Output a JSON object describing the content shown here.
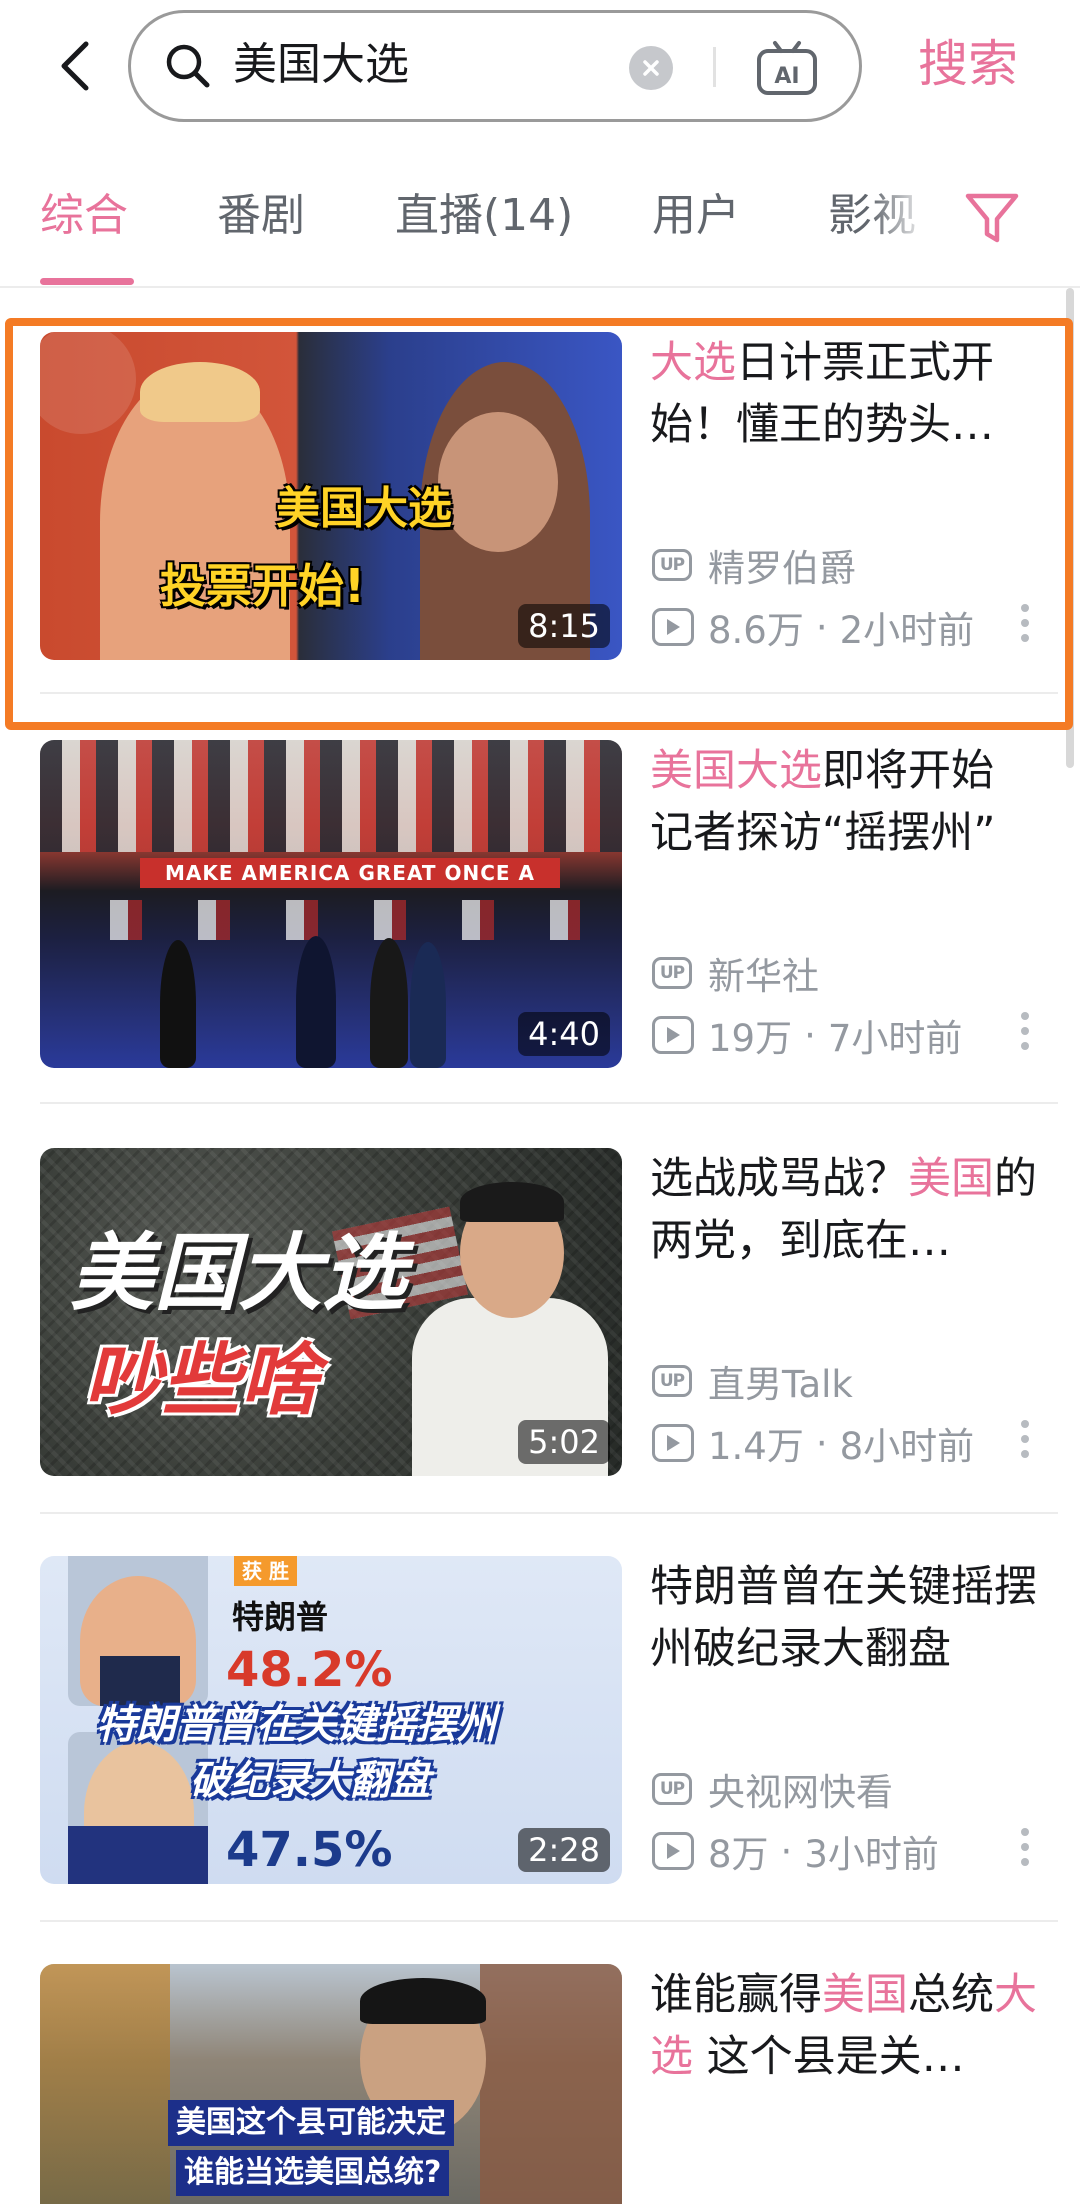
{
  "search": {
    "query": "美国大选",
    "ai_label": "AI",
    "submit_label": "搜索"
  },
  "tabs": [
    {
      "label": "综合",
      "active": true
    },
    {
      "label": "番剧",
      "active": false
    },
    {
      "label": "直播(14)",
      "active": false
    },
    {
      "label": "用户",
      "active": false
    },
    {
      "label": "影视",
      "active": false
    }
  ],
  "results": [
    {
      "title_highlight": "大选",
      "title_rest": "日计票正式开始！懂王的势头…",
      "uploader": "精罗伯爵",
      "views": "8.6万",
      "time": "2小时前",
      "duration": "8:15",
      "thumb_caption_1": "美国大选",
      "thumb_caption_2": "投票开始!"
    },
    {
      "title_highlight": "美国大选",
      "title_rest": "即将开始 记者探访“摇摆州”",
      "uploader": "新华社",
      "views": "19万",
      "time": "7小时前",
      "duration": "4:40",
      "thumb_caption_1": "MAKE AMERICA GREAT ONCE A"
    },
    {
      "title_prefix": "选战成骂战？",
      "title_highlight": "美国",
      "title_rest": "的两党，到底在…",
      "uploader": "直男Talk",
      "views": "1.4万",
      "time": "8小时前",
      "duration": "5:02",
      "thumb_caption_1": "美国大选",
      "thumb_caption_2": "吵些啥"
    },
    {
      "title_rest": "特朗普曾在关键摇摆州破纪录大翻盘",
      "uploader": "央视网快看",
      "views": "8万",
      "time": "3小时前",
      "duration": "2:28",
      "thumb_tag": "获 胜",
      "thumb_name": "特朗普",
      "thumb_pct_1": "48.2%",
      "thumb_pct_2": "47.5%",
      "thumb_caption_1": "特朗普曾在关键摇摆州",
      "thumb_caption_2": "破纪录大翻盘"
    },
    {
      "title_prefix": "谁能赢得",
      "title_highlight": "美国",
      "title_mid": "总统",
      "title_highlight_2": "大选",
      "title_rest": " 这个县是关…",
      "thumb_caption_1": "美国这个县可能决定",
      "thumb_caption_2": "谁能当选美国总统?"
    }
  ],
  "colors": {
    "accent_pink": "#e8739b",
    "highlight_orange": "#f47b25",
    "meta_gray": "#9499a0"
  }
}
